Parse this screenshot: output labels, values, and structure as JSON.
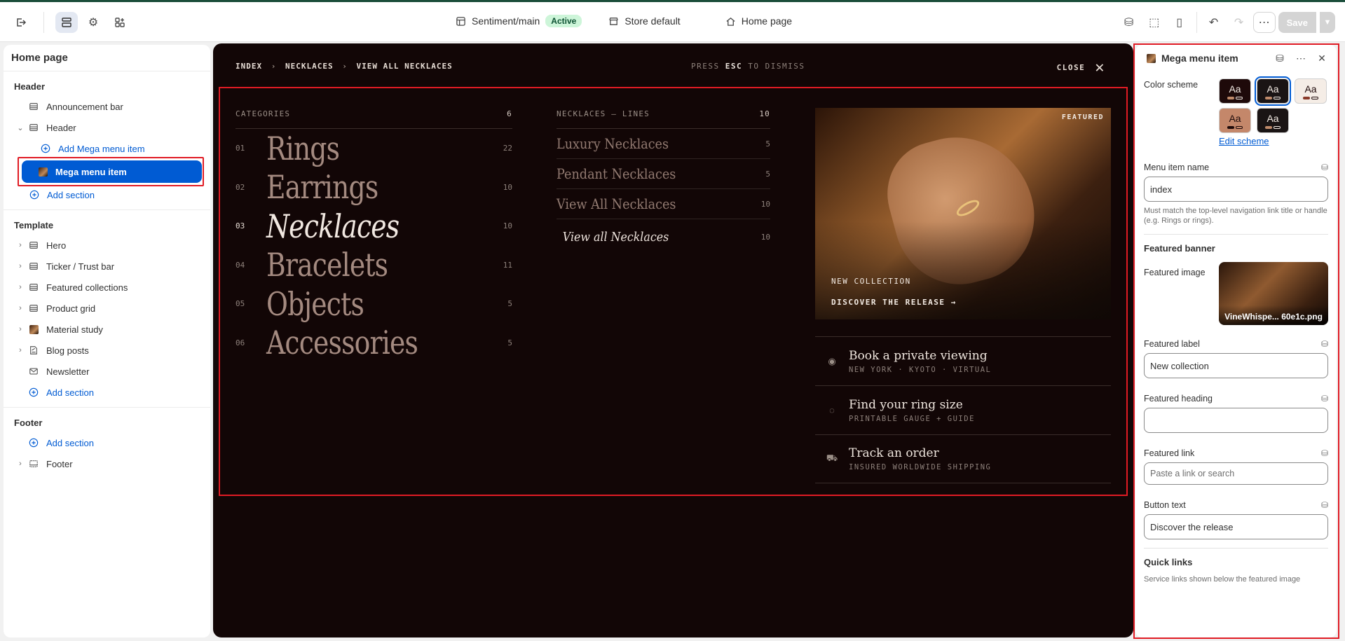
{
  "topbar": {
    "theme_name": "Sentiment/main",
    "status_badge": "Active",
    "store": "Store default",
    "page": "Home page",
    "save_label": "Save"
  },
  "sidebar": {
    "title": "Home page",
    "header_group": {
      "title": "Header",
      "items": [
        {
          "label": "Announcement bar"
        },
        {
          "label": "Header"
        },
        {
          "label": "Add Mega menu item"
        },
        {
          "label": "Mega menu item"
        },
        {
          "label": "Add section"
        }
      ]
    },
    "template_group": {
      "title": "Template",
      "items": [
        {
          "label": "Hero"
        },
        {
          "label": "Ticker / Trust bar"
        },
        {
          "label": "Featured collections"
        },
        {
          "label": "Product grid"
        },
        {
          "label": "Material study"
        },
        {
          "label": "Blog posts"
        },
        {
          "label": "Newsletter"
        },
        {
          "label": "Add section"
        }
      ]
    },
    "footer_group": {
      "title": "Footer",
      "items": [
        {
          "label": "Add section"
        },
        {
          "label": "Footer"
        }
      ]
    }
  },
  "preview": {
    "breadcrumb": [
      "INDEX",
      "NECKLACES",
      "VIEW ALL NECKLACES"
    ],
    "dismiss_prefix": "PRESS",
    "dismiss_key": "ESC",
    "dismiss_suffix": "TO DISMISS",
    "close_label": "CLOSE",
    "categories": {
      "heading": "CATEGORIES",
      "count": "6",
      "items": [
        {
          "num": "01",
          "name": "Rings",
          "count": "22"
        },
        {
          "num": "02",
          "name": "Earrings",
          "count": "10"
        },
        {
          "num": "03",
          "name": "Necklaces",
          "count": "10"
        },
        {
          "num": "04",
          "name": "Bracelets",
          "count": "11"
        },
        {
          "num": "05",
          "name": "Objects",
          "count": "5"
        },
        {
          "num": "06",
          "name": "Accessories",
          "count": "5"
        }
      ]
    },
    "lines": {
      "heading": "NECKLACES — LINES",
      "count": "10",
      "items": [
        {
          "name": "Luxury Necklaces",
          "count": "5"
        },
        {
          "name": "Pendant Necklaces",
          "count": "5"
        },
        {
          "name": "View All Necklaces",
          "count": "10"
        },
        {
          "name": "View all Necklaces",
          "count": "10"
        }
      ]
    },
    "featured": {
      "badge": "FEATURED",
      "label": "NEW COLLECTION",
      "link": "DISCOVER THE RELEASE →"
    },
    "services": [
      {
        "icon": "eye-icon",
        "title": "Book a private viewing",
        "subtitle": "NEW YORK · KYOTO · VIRTUAL"
      },
      {
        "icon": "ring-icon",
        "title": "Find your ring size",
        "subtitle": "PRINTABLE GAUGE + GUIDE"
      },
      {
        "icon": "truck-icon",
        "title": "Track an order",
        "subtitle": "INSURED WORLDWIDE SHIPPING"
      }
    ]
  },
  "panel": {
    "title": "Mega menu item",
    "color_scheme_label": "Color scheme",
    "swatch_text": "Aa",
    "edit_scheme": "Edit scheme",
    "menu_item_name_label": "Menu item name",
    "menu_item_name_value": "index",
    "menu_item_help": "Must match the top-level navigation link title or handle (e.g. Rings or rings).",
    "featured_banner_title": "Featured banner",
    "featured_image_label": "Featured image",
    "featured_image_file": "VineWhispe... 60e1c.png",
    "featured_label_label": "Featured label",
    "featured_label_value": "New collection",
    "featured_heading_label": "Featured heading",
    "featured_heading_value": "",
    "featured_link_label": "Featured link",
    "featured_link_placeholder": "Paste a link or search",
    "button_text_label": "Button text",
    "button_text_value": "Discover the release",
    "quick_links_title": "Quick links",
    "quick_links_help": "Service links shown below the featured image"
  }
}
